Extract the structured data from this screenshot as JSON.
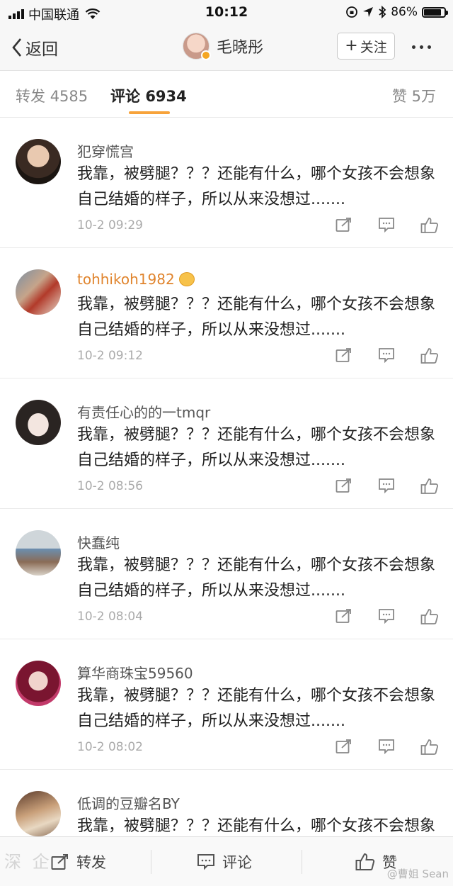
{
  "status_bar": {
    "carrier": "中国联通",
    "time": "10:12",
    "battery": "86%",
    "battery_level": 0.86
  },
  "nav": {
    "back_label": "返回",
    "user_name": "毛晓彤",
    "follow_label": "关注"
  },
  "tabs": {
    "repost_label": "转发",
    "repost_count": "4585",
    "comment_label": "评论",
    "comment_count": "6934",
    "like_label": "赞",
    "like_count": "5万"
  },
  "comments": [
    {
      "user": "犯穿慌宫",
      "text": "我靠，被劈腿？？？还能有什么，哪个女孩不会想象自己结婚的样子，所以从来没想过.......",
      "time": "10-2 09:29"
    },
    {
      "user": "tohhikoh1982",
      "text": "我靠，被劈腿？？？还能有什么，哪个女孩不会想象自己结婚的样子，所以从来没想过.......",
      "time": "10-2 09:12"
    },
    {
      "user": "有责任心的的一tmqr",
      "text": "我靠，被劈腿？？？还能有什么，哪个女孩不会想象自己结婚的样子，所以从来没想过.......",
      "time": "10-2 08:56"
    },
    {
      "user": "快蠢纯",
      "text": "我靠，被劈腿？？？还能有什么，哪个女孩不会想象自己结婚的样子，所以从来没想过.......",
      "time": "10-2 08:04"
    },
    {
      "user": "算华商珠宝59560",
      "text": "我靠，被劈腿？？？还能有什么，哪个女孩不会想象自己结婚的样子，所以从来没想过.......",
      "time": "10-2 08:02"
    },
    {
      "user": "低调的豆瓣名BY",
      "text": "我靠，被劈腿？？？还能有什么，哪个女孩不会想象自己结婚的样子，所以从来没想过.......",
      "time": ""
    }
  ],
  "toolbar": {
    "repost_label": "转发",
    "comment_label": "评论",
    "like_label": "赞"
  },
  "watermark": {
    "left": "深 企",
    "right": "@曹姐 Sean"
  },
  "colors": {
    "accent": "#f7a33b",
    "gold_name": "#e0842d"
  }
}
